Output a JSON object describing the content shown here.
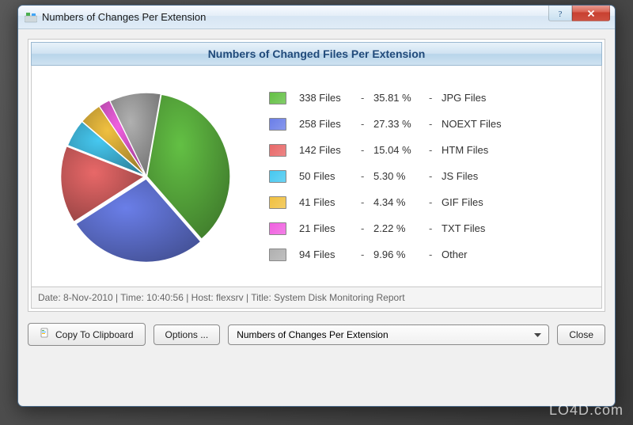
{
  "window": {
    "title": "Numbers of Changes Per Extension"
  },
  "panel": {
    "header": "Numbers of Changed Files Per Extension"
  },
  "chart_data": {
    "type": "pie",
    "title": "Numbers of Changed Files Per Extension",
    "series": [
      {
        "name": "JPG Files",
        "count": 338,
        "percent": 35.81,
        "color": "#63c044",
        "label": "338 Files",
        "pct_label": "35.81 %"
      },
      {
        "name": "NOEXT Files",
        "count": 258,
        "percent": 27.33,
        "color": "#6a7ee8",
        "label": "258 Files",
        "pct_label": "27.33 %"
      },
      {
        "name": "HTM Files",
        "count": 142,
        "percent": 15.04,
        "color": "#e86868",
        "label": "142 Files",
        "pct_label": "15.04 %"
      },
      {
        "name": "JS Files",
        "count": 50,
        "percent": 5.3,
        "color": "#46c8f0",
        "label": "50 Files",
        "pct_label": "5.30 %"
      },
      {
        "name": "GIF Files",
        "count": 41,
        "percent": 4.34,
        "color": "#f0c040",
        "label": "41 Files",
        "pct_label": "4.34 %"
      },
      {
        "name": "TXT Files",
        "count": 21,
        "percent": 2.22,
        "color": "#f060e0",
        "label": "21 Files",
        "pct_label": "2.22 %"
      },
      {
        "name": "Other",
        "count": 94,
        "percent": 9.96,
        "color": "#b0b0b0",
        "label": "94 Files",
        "pct_label": "9.96 %"
      }
    ]
  },
  "status": {
    "text": "Date: 8-Nov-2010 | Time: 10:40:56 | Host: flexsrv | Title: System Disk Monitoring Report"
  },
  "buttons": {
    "copy": "Copy To Clipboard",
    "options": "Options ...",
    "close": "Close"
  },
  "dropdown": {
    "selected": "Numbers of Changes Per Extension"
  },
  "watermark": "LO4D.com"
}
